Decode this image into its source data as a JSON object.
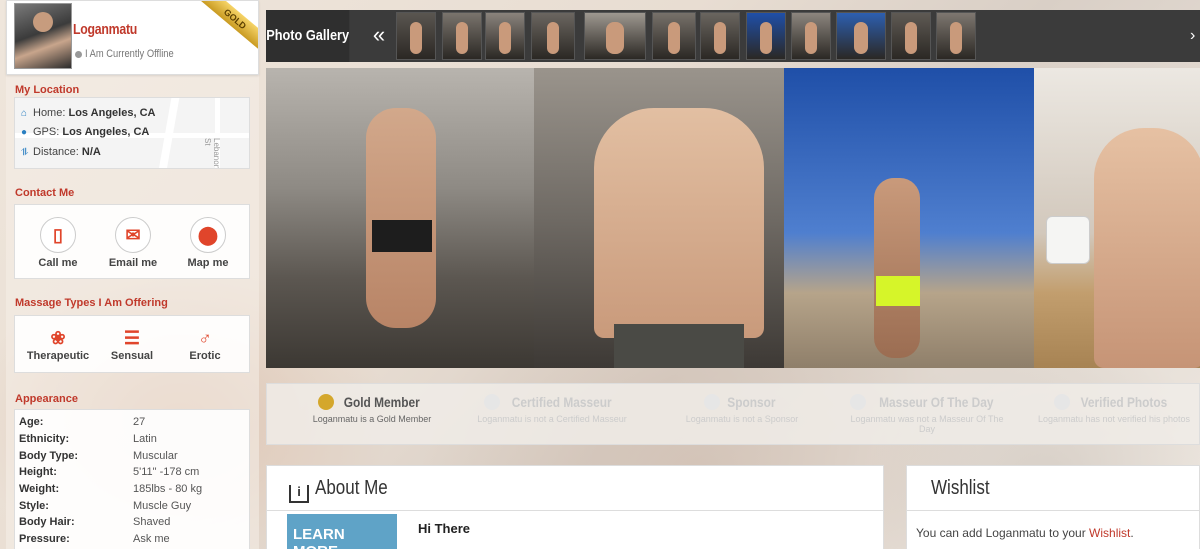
{
  "profile": {
    "username": "Loganmatu",
    "status": "I Am Currently Offline",
    "badge": "GOLD"
  },
  "location": {
    "title": "My Location",
    "home_label": "Home:",
    "home_value": "Los Angeles, CA",
    "gps_label": "GPS:",
    "gps_value": "Los Angeles, CA",
    "distance_label": "Distance:",
    "distance_value": "N/A",
    "map_street": "Lebanon St"
  },
  "contact": {
    "title": "Contact Me",
    "items": [
      {
        "label": "Call me",
        "icon": "phone-icon"
      },
      {
        "label": "Email me",
        "icon": "email-icon"
      },
      {
        "label": "Map me",
        "icon": "map-pin-icon"
      }
    ]
  },
  "massage": {
    "title": "Massage Types I Am Offering",
    "items": [
      {
        "label": "Therapeutic",
        "icon": "lotus-icon"
      },
      {
        "label": "Sensual",
        "icon": "stones-icon"
      },
      {
        "label": "Erotic",
        "icon": "male-symbol-icon"
      }
    ]
  },
  "appearance": {
    "title": "Appearance",
    "rows": [
      {
        "key": "Age:",
        "value": "27"
      },
      {
        "key": "Ethnicity:",
        "value": "Latin"
      },
      {
        "key": "Body Type:",
        "value": "Muscular"
      },
      {
        "key": "Height:",
        "value": "5'11\" -178 cm"
      },
      {
        "key": "Weight:",
        "value": "185lbs - 80 kg"
      },
      {
        "key": "Style:",
        "value": "Muscle Guy"
      },
      {
        "key": "Body Hair:",
        "value": "Shaved"
      },
      {
        "key": "Pressure:",
        "value": "Ask me"
      }
    ]
  },
  "gallery": {
    "title": "Photo Gallery",
    "prev": "«",
    "next": "›",
    "thumb_count": 12
  },
  "badges": [
    {
      "title": "Gold Member",
      "sub": "Loganmatu is a Gold Member",
      "active": true
    },
    {
      "title": "Certified Masseur",
      "sub": "Loganmatu is not a Certified Masseur",
      "active": false
    },
    {
      "title": "Sponsor",
      "sub": "Loganmatu is not a Sponsor",
      "active": false
    },
    {
      "title": "Masseur Of The Day",
      "sub": "Loganmatu was not a Masseur Of The Day",
      "active": false
    },
    {
      "title": "Verified Photos",
      "sub": "Loganmatu has not verified his photos",
      "active": false
    }
  ],
  "about": {
    "title": "About Me",
    "learn_more": "LEARN MORE",
    "greeting": "Hi There"
  },
  "wishlist": {
    "title": "Wishlist",
    "text_before": "You can add Loganmatu to your ",
    "link": "Wishlist",
    "text_after": "."
  },
  "colors": {
    "accent": "#c0392b",
    "gallery_bar": "#3b3b3b",
    "gold": "#d4a72c"
  }
}
